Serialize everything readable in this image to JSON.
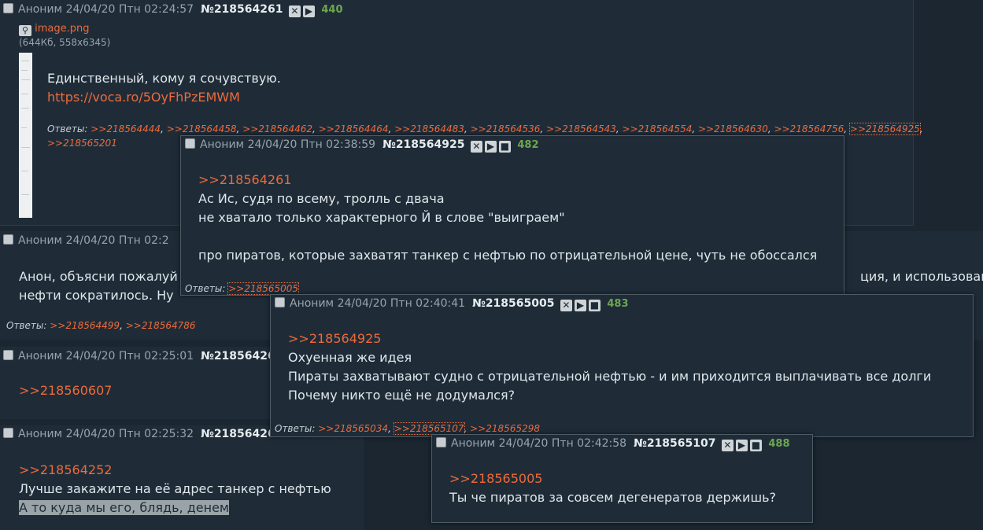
{
  "author_name": "Аноним",
  "replies_label": "Ответы:",
  "op": {
    "date": "24/04/20 Птн 02:24:57",
    "number": "№218564261",
    "count": "440",
    "file_name": "image.png",
    "file_info": "(644Кб, 558x6345)",
    "text": [
      "Единственный, кому я сочувствую."
    ],
    "url": "https://voca.ro/5OyFhPzEMWM",
    "replies": [
      ">>218564444",
      ">>218564458",
      ">>218564462",
      ">>218564464",
      ">>218564483",
      ">>218564536",
      ">>218564543",
      ">>218564554",
      ">>218564630",
      ">>218564756",
      ">>218564925",
      ">>218565201"
    ]
  },
  "post2": {
    "date": "24/04/20 Птн 02:2",
    "lines": [
      "Анон, объясни пожалуй",
      "нефти сократилось. Ну"
    ],
    "right_line": "ция, и использовани",
    "replies": [
      ">>218564499",
      ">>218564786"
    ]
  },
  "post3": {
    "date": "24/04/20 Птн 02:25:01",
    "number": "№21856426",
    "link": ">>218560607"
  },
  "post4": {
    "date": "24/04/20 Птн 02:25:32",
    "number": "№21856426",
    "link": ">>218564252",
    "lines": [
      "Лучше закажите на её адрес танкер с нефтью",
      "А то куда мы его, блядь, денем"
    ]
  },
  "popup1": {
    "date": "24/04/20 Птн 02:38:59",
    "number": "№218564925",
    "count": "482",
    "link": ">>218564261",
    "lines": [
      "Ас Ис, судя по всему, тролль с двача",
      "не хватало только характерного Й в слове \"выиграем\"",
      "",
      "про пиратов, которые захватят танкер с нефтью по отрицательной цене, чуть не обоссался"
    ],
    "replies": [
      ">>218565005"
    ]
  },
  "popup2": {
    "date": "24/04/20 Птн 02:40:41",
    "number": "№218565005",
    "count": "483",
    "link": ">>218564925",
    "lines": [
      "Охуенная же идея",
      "Пираты захватывают судно с отрицательной нефтью - и им приходится выплачивать все долги",
      "Почему никто ещё не додумался?"
    ],
    "replies": [
      ">>218565034",
      ">>218565107",
      ">>218565298"
    ]
  },
  "popup3": {
    "date": "24/04/20 Птн 02:42:58",
    "number": "№218565107",
    "count": "488",
    "link": ">>218565005",
    "lines": [
      "Ты че пиратов за совсем дегенератов держишь?"
    ]
  },
  "icons": {
    "hide": "close-icon",
    "expand": "play-icon",
    "stop": "stop-icon",
    "search": "magnifier-icon"
  },
  "colors": {
    "link": "#ed6a3a",
    "background": "#1b2630",
    "post": "#1f2c38",
    "count": "#6da74f"
  }
}
